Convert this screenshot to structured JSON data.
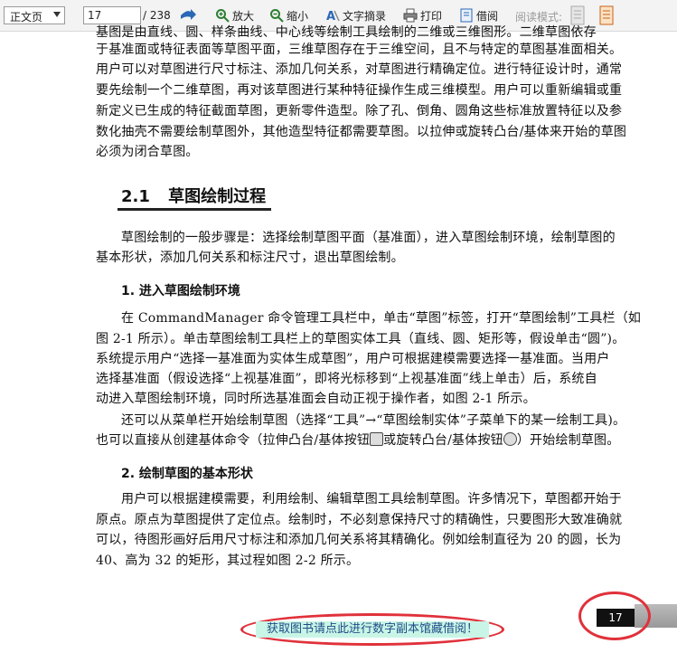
{
  "toolbar": {
    "view_mode": "正文页",
    "page_input": "17",
    "page_total": "/ 238",
    "zoom_in": "放大",
    "zoom_out": "缩小",
    "text_extract": "文字摘录",
    "print": "打印",
    "borrow": "借阅",
    "reading_mode": "阅读模式:"
  },
  "content": {
    "para1_lines": [
      "基图是由直线、圆、样条曲线、中心线等绘制工具绘制的二维或三维图形。二维草图依存",
      "于基准面或特征表面等草图平面，三维草图存在于三维空间，且不与特定的草图基准面相关。",
      "用户可以对草图进行尺寸标注、添加几何关系，对草图进行精确定位。进行特征设计时，通常",
      "要先绘制一个二维草图，再对该草图进行某种特征操作生成三维模型。用户可以重新编辑或重",
      "新定义已生成的特征截面草图，更新零件造型。除了孔、倒角、圆角这些标准放置特征以及参",
      "数化抽壳不需要绘制草图外，其他造型特征都需要草图。以拉伸或旋转凸台/基体来开始的草图",
      "必须为闭合草图。"
    ],
    "section_number": "2.1",
    "section_title": "草图绘制过程",
    "para2_lines": [
      "草图绘制的一般步骤是：选择绘制草图平面（基准面），进入草图绘制环境，绘制草图的",
      "基本形状，添加几何关系和标注尺寸，退出草图绘制。"
    ],
    "step1_title": "1.  进入草图绘制环境",
    "para3_lines": [
      "在 CommandManager 命令管理工具栏中，单击“草图”标签，打开“草图绘制”工具栏（如",
      "图 2-1 所示）。单击草图绘制工具栏上的草图实体工具（直线、圆、矩形等，假设单击“圆”)。",
      "系统提示用户“选择一基准面为实体生成草图”，用户可根据建模需要选择一基准面。当用户",
      "选择基准面（假设选择“上视基准面”，即将光标移到“上视基准面”线上单击）后，系统自",
      "动进入草图绘制环境，同时所选基准面会自动正视于操作者，如图 2-1 所示。"
    ],
    "para4_line1": "还可以从菜单栏开始绘制草图（选择“工具”→“草图绘制实体”子菜单下的某一绘制工具)。",
    "para4_line2_a": "也可以直接从创建基体命令（拉伸凸台/基体按钮",
    "para4_line2_b": "或旋转凸台/基体按钮",
    "para4_line2_c": "）开始绘制草图。",
    "step2_title": "2.  绘制草图的基本形状",
    "para5_lines": [
      "用户可以根据建模需要，利用绘制、编辑草图工具绘制草图。许多情况下，草图都开始于",
      "原点。原点为草图提供了定位点。绘制时，不必刻意保持尺寸的精确性，只要图形大致准确就",
      "可以，待图形画好后用尺寸标注和添加几何关系将其精确化。例如绘制直径为 20 的圆，长为",
      "40、高为 32 的矩形，其过程如图 2-2 所示。"
    ],
    "page_number": "17"
  },
  "footer": {
    "borrow_link": "获取图书请点此进行数字副本馆藏借阅！"
  }
}
